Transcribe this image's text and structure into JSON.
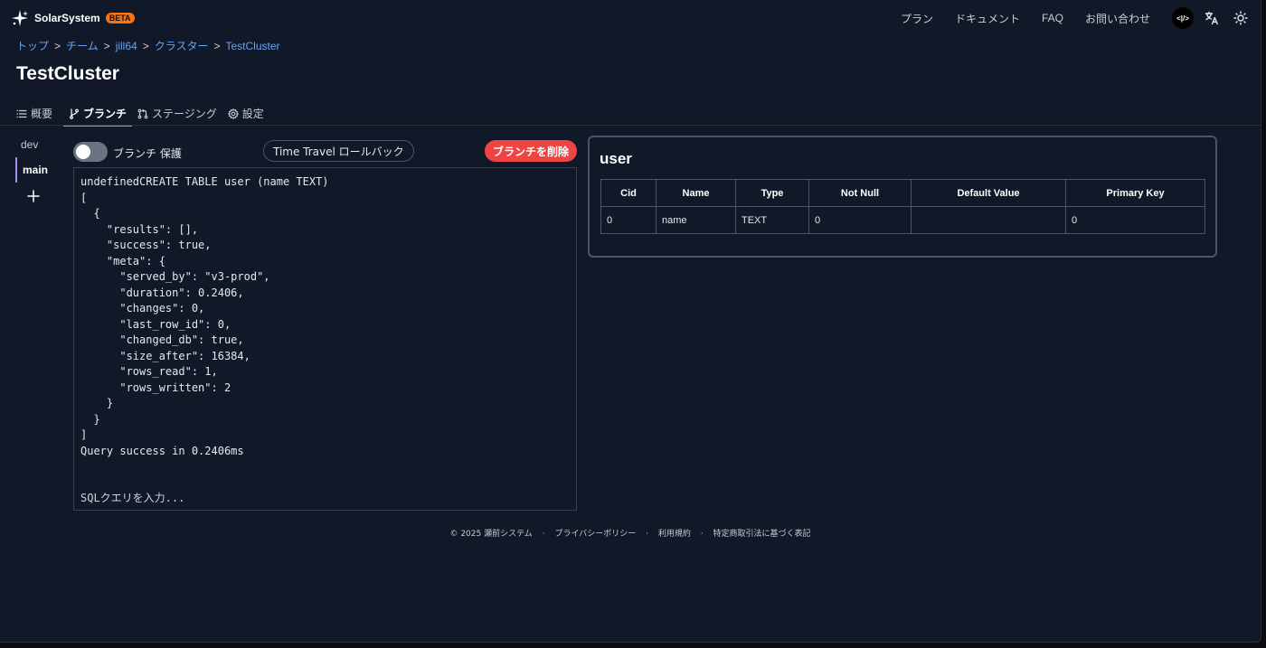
{
  "brand": {
    "name": "SolarSystem",
    "badge": "BETA"
  },
  "nav": {
    "links": [
      "プラン",
      "ドキュメント",
      "FAQ",
      "お問い合わせ"
    ],
    "code_badge": "<|/>",
    "icons": [
      "translate-icon",
      "sun-icon"
    ]
  },
  "breadcrumb": [
    "トップ",
    "チーム",
    "jill64",
    "クラスター",
    "TestCluster"
  ],
  "breadcrumb_separator": ">",
  "page_title": "TestCluster",
  "tabs": [
    {
      "label": "概要",
      "icon": "list-icon",
      "active": false
    },
    {
      "label": "ブランチ",
      "icon": "git-branch-icon",
      "active": true
    },
    {
      "label": "ステージング",
      "icon": "git-pull-request-icon",
      "active": false
    },
    {
      "label": "設定",
      "icon": "gear-icon",
      "active": false
    }
  ],
  "branches": [
    "dev",
    "main"
  ],
  "active_branch": "main",
  "controls": {
    "protect_label": "ブランチ 保護",
    "protect_enabled": false,
    "time_travel_label": "Time Travel ロールバック",
    "delete_label": "ブランチを削除"
  },
  "console": {
    "output": "undefinedCREATE TABLE user (name TEXT)\n[\n  {\n    \"results\": [],\n    \"success\": true,\n    \"meta\": {\n      \"served_by\": \"v3-prod\",\n      \"duration\": 0.2406,\n      \"changes\": 0,\n      \"last_row_id\": 0,\n      \"changed_db\": true,\n      \"size_after\": 16384,\n      \"rows_read\": 1,\n      \"rows_written\": 2\n    }\n  }\n]\nQuery success in 0.2406ms",
    "input_value": "",
    "input_placeholder": "SQLクエリを入力..."
  },
  "schema": {
    "table_name": "user",
    "columns": [
      "Cid",
      "Name",
      "Type",
      "Not Null",
      "Default Value",
      "Primary Key"
    ],
    "rows": [
      [
        "0",
        "name",
        "TEXT",
        "0",
        "",
        "0"
      ]
    ]
  },
  "footer": {
    "copyright": "© 2025 瀬前システム",
    "links": [
      "プライバシーポリシー",
      "利用規約",
      "特定商取引法に基づく表記"
    ],
    "separator": "·"
  },
  "colors": {
    "background": "#111827",
    "link": "#60a5fa",
    "accent": "#a78bfa",
    "danger": "#ef4444",
    "beta": "#f97316"
  }
}
